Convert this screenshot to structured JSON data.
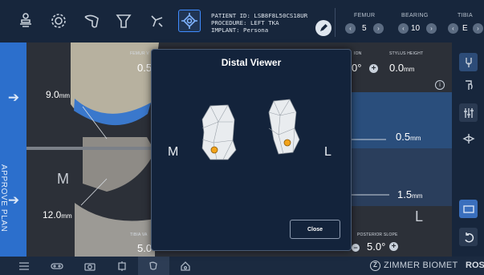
{
  "patient": {
    "id_line": "PATIENT ID: LSB8F8L50CS18UR",
    "procedure_line": "PROCEDURE: LEFT TKA",
    "implant_line": "IMPLANT: Persona"
  },
  "components": [
    {
      "title": "FEMUR",
      "value": "5"
    },
    {
      "title": "BEARING",
      "value": "10"
    },
    {
      "title": "TIBIA",
      "value": "E"
    }
  ],
  "approve_plan": "APPROVE PLAN",
  "stage": {
    "top_left_value": "9.0",
    "bottom_left_value": "12.0",
    "unit": "mm",
    "medial_letter": "M",
    "lateral_letter": "L",
    "femur_varus_title": "FEMUR V",
    "femur_varus_value": "0.5",
    "tibia_varus_title": "TIBIA VA",
    "tibia_varus_value": "5.0",
    "top_angle_value": "0°",
    "top_angle_title": "ION",
    "stylus_title": "STYLUS HEIGHT",
    "stylus_value": "0.0",
    "right_mid_value": "0.5",
    "right_low_value": "1.5",
    "slope_title": "POSTERIOR SLOPE",
    "slope_value": "5.0°",
    "info_icon": "i"
  },
  "modal": {
    "title": "Distal Viewer",
    "medial": "M",
    "lateral": "L",
    "close_label": "Close"
  },
  "brand": {
    "name": "ZIMMER BIOMET",
    "suffix": "ROS",
    "logo_letter": "Z"
  },
  "colors": {
    "accent": "#3f8cff",
    "approve_panel": "#2c6fcc",
    "marker": "#f2a31b"
  }
}
